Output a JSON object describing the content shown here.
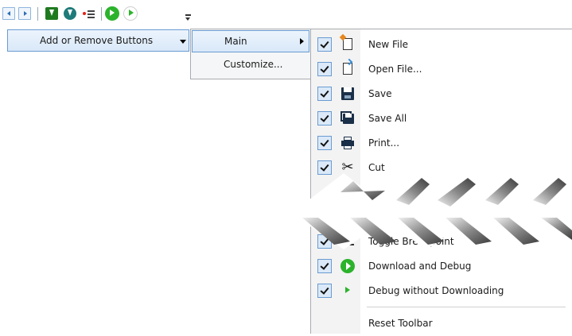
{
  "toolbar": {
    "buttons": [
      {
        "name": "back-icon"
      },
      {
        "name": "forward-icon"
      },
      {
        "name": "download-icon"
      },
      {
        "name": "download-alt-icon"
      },
      {
        "name": "toggle-breakpoint-icon"
      },
      {
        "name": "download-and-debug-icon"
      },
      {
        "name": "debug-without-downloading-icon"
      },
      {
        "name": "toolbar-overflow-icon"
      }
    ]
  },
  "overflow_menu": {
    "add_remove_label": "Add or Remove Buttons"
  },
  "submenu": {
    "main_label": "Main",
    "customize_label": "Customize..."
  },
  "button_list": {
    "items": [
      {
        "label": "New File",
        "checked": true,
        "icon": "new-file-icon"
      },
      {
        "label": "Open File...",
        "checked": true,
        "icon": "open-file-icon"
      },
      {
        "label": "Save",
        "checked": true,
        "icon": "save-icon"
      },
      {
        "label": "Save All",
        "checked": true,
        "icon": "save-all-icon"
      },
      {
        "label": "Print...",
        "checked": true,
        "icon": "print-icon"
      },
      {
        "label": "Cut",
        "checked": true,
        "icon": "cut-icon"
      },
      {
        "label": "Toggle Breakpoint",
        "checked": true,
        "icon": "breakpoint-icon"
      },
      {
        "label": "Download and Debug",
        "checked": true,
        "icon": "download-debug-icon"
      },
      {
        "label": "Debug without Downloading",
        "checked": true,
        "icon": "debug-no-download-icon"
      }
    ],
    "reset_label": "Reset Toolbar"
  },
  "colors": {
    "selection_border": "#6a9bd1",
    "selection_fill": "#dbe9f8",
    "play_green": "#2cb32c"
  }
}
